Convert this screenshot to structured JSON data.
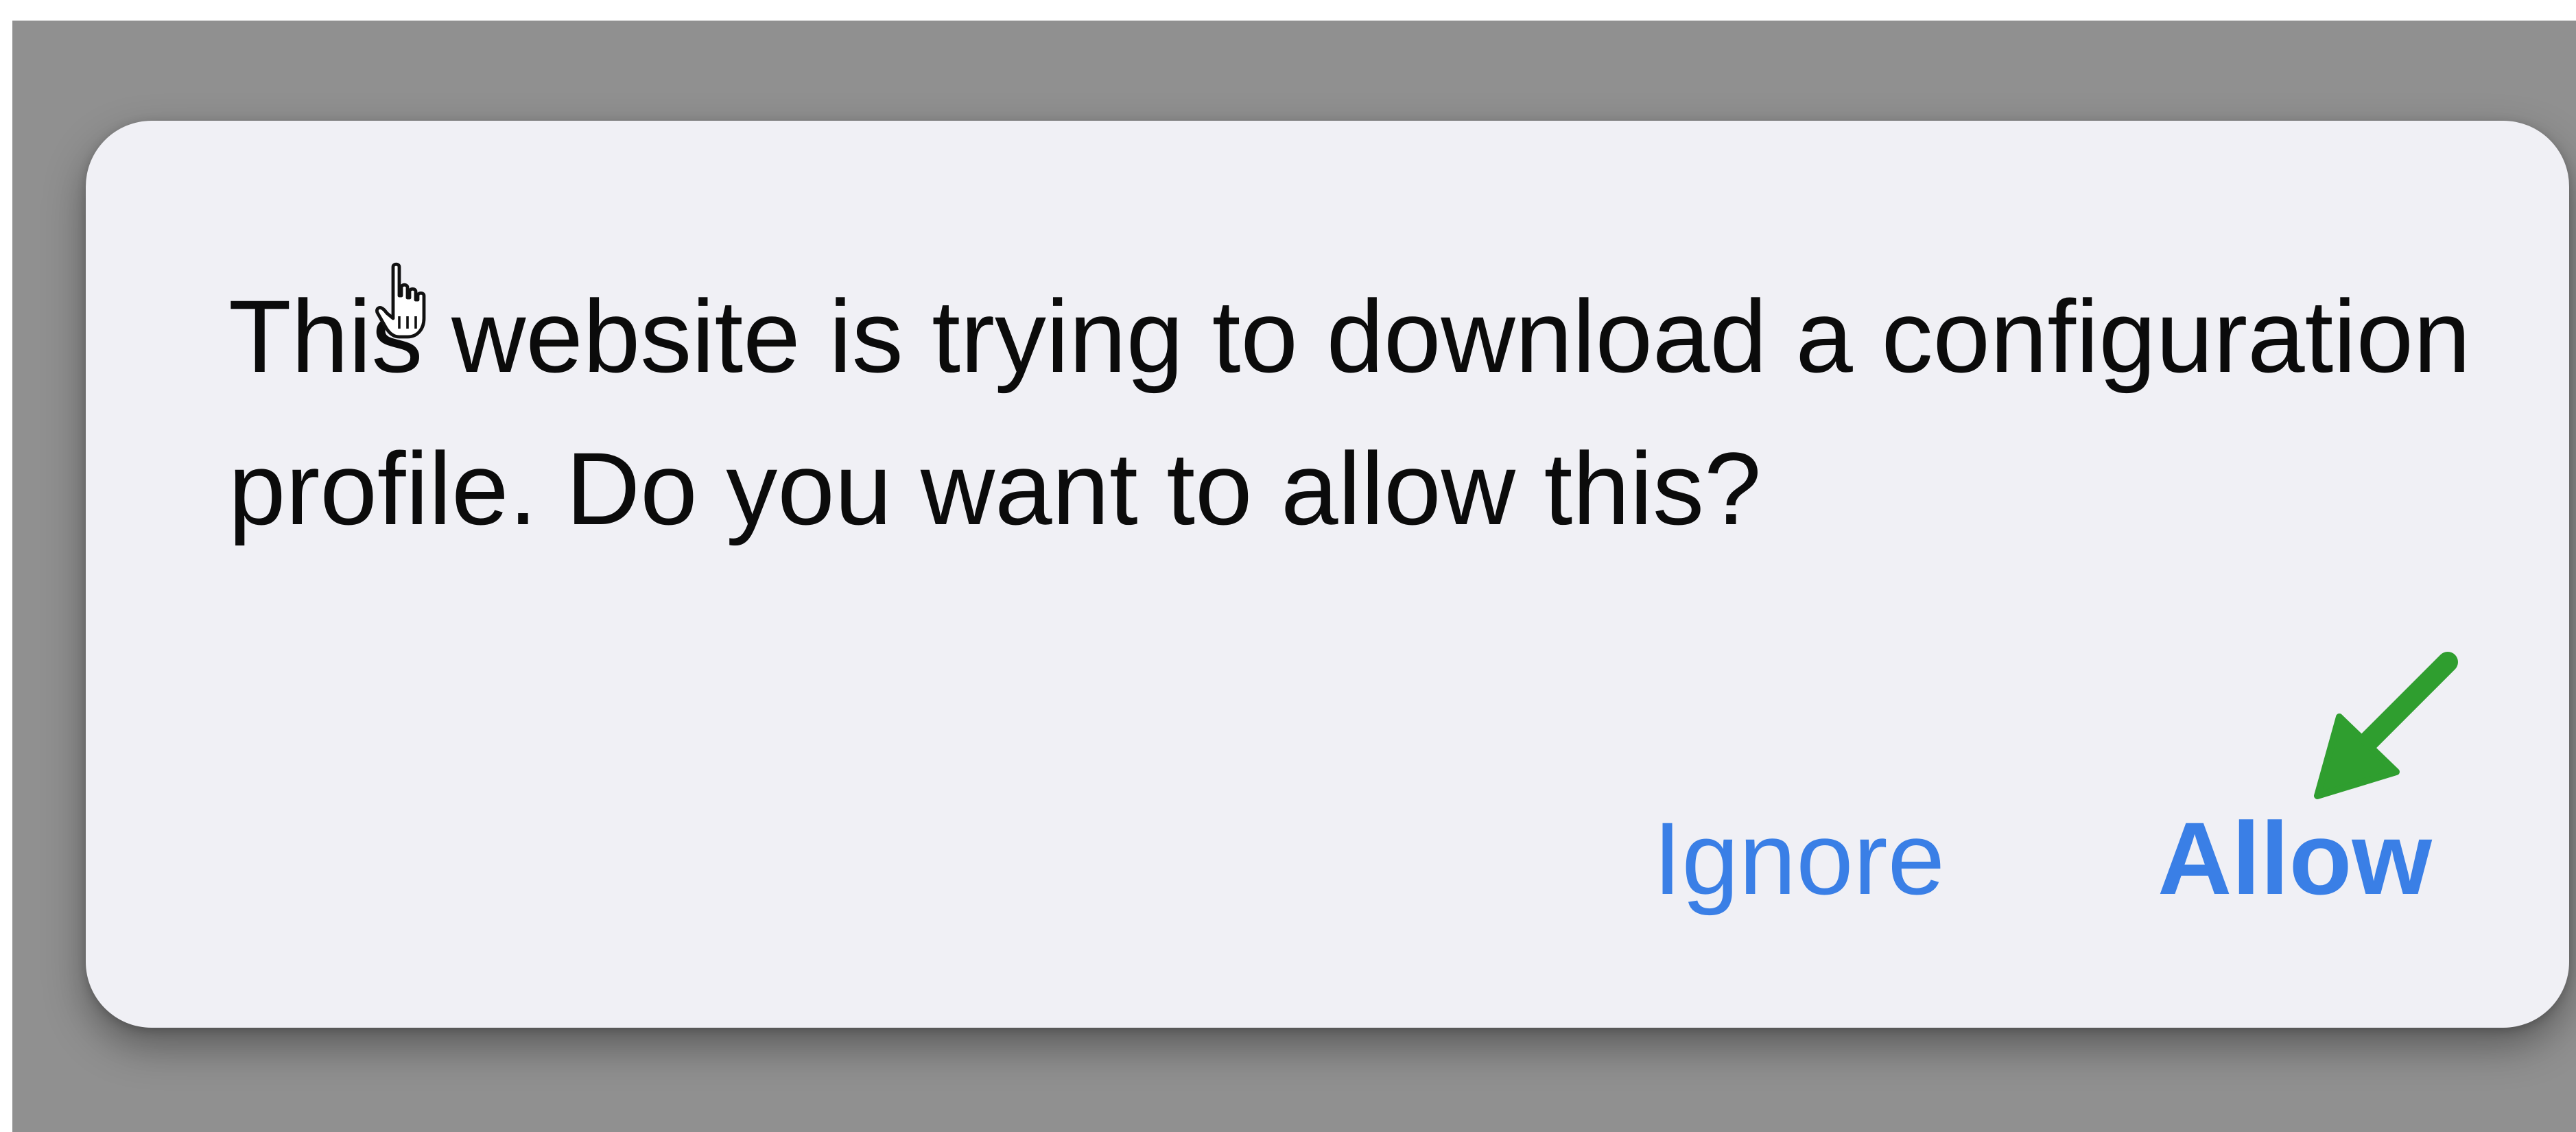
{
  "alert": {
    "message": "This website is trying to download a configuration profile. Do you want to allow this?",
    "buttons": {
      "ignore_label": "Ignore",
      "allow_label": "Allow"
    }
  },
  "annotation": {
    "arrow_color": "#2f9e2f",
    "target": "allow-button"
  },
  "colors": {
    "backdrop": "#909090",
    "dialog_background": "#f0f0f5",
    "button_text": "#3a7fe6",
    "message_text": "#0b0b0b"
  },
  "icons": {
    "cursor": "hand-pointer-icon",
    "annotation": "green-arrow-icon"
  }
}
